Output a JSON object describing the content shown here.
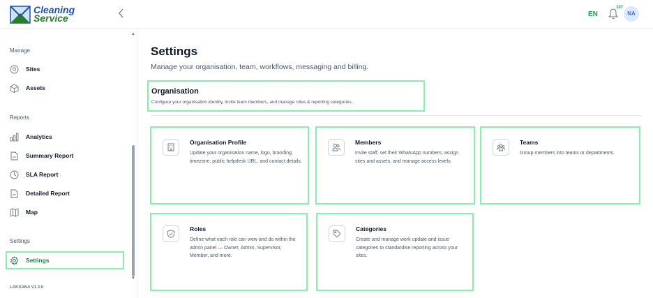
{
  "app": {
    "logo_line1": "Cleaning",
    "logo_line2": "Service",
    "language": "EN",
    "notification_count": "107",
    "user_initials": "NA",
    "version": "LAKSANA V1.3.0"
  },
  "sidebar": {
    "groups": [
      {
        "title": "Manage",
        "items": [
          {
            "label": "Sites",
            "icon": "pin-icon"
          },
          {
            "label": "Assets",
            "icon": "cube-icon"
          }
        ]
      },
      {
        "title": "Reports",
        "items": [
          {
            "label": "Analytics",
            "icon": "bar-chart-icon"
          },
          {
            "label": "Summary Report",
            "icon": "document-icon"
          },
          {
            "label": "SLA Report",
            "icon": "clock-icon"
          },
          {
            "label": "Detailed Report",
            "icon": "document-icon"
          },
          {
            "label": "Map",
            "icon": "map-icon"
          }
        ]
      },
      {
        "title": "Settings",
        "items": [
          {
            "label": "Settings",
            "icon": "gear-icon",
            "active": true
          }
        ]
      }
    ]
  },
  "main": {
    "title": "Settings",
    "subtitle": "Manage your organisation, team, workflows, messaging and billing.",
    "section": {
      "title": "Organisation",
      "subtitle": "Configure your organisation identity, invite team members, and manage roles & reporting categories."
    },
    "cards": [
      {
        "title": "Organisation Profile",
        "description": "Update your organisation name, logo, branding, timezone, public helpdesk URL, and contact details.",
        "icon": "building-icon"
      },
      {
        "title": "Members",
        "description": "Invite staff, set their WhatsApp numbers, assign sites and assets, and manage access levels.",
        "icon": "users-icon"
      },
      {
        "title": "Teams",
        "description": "Group members into teams or departments.",
        "icon": "team-icon"
      },
      {
        "title": "Roles",
        "description": "Define what each role can view and do within the admin panel — Owner, Admin, Supervisor, Member, and more.",
        "icon": "shield-check-icon"
      },
      {
        "title": "Categories",
        "description": "Create and manage work update and issue categories to standardise reporting across your sites.",
        "icon": "tag-icon"
      }
    ]
  },
  "colors": {
    "accent": "#16a34a",
    "highlight": "#86efac",
    "brand_blue": "#1f4fa6"
  }
}
